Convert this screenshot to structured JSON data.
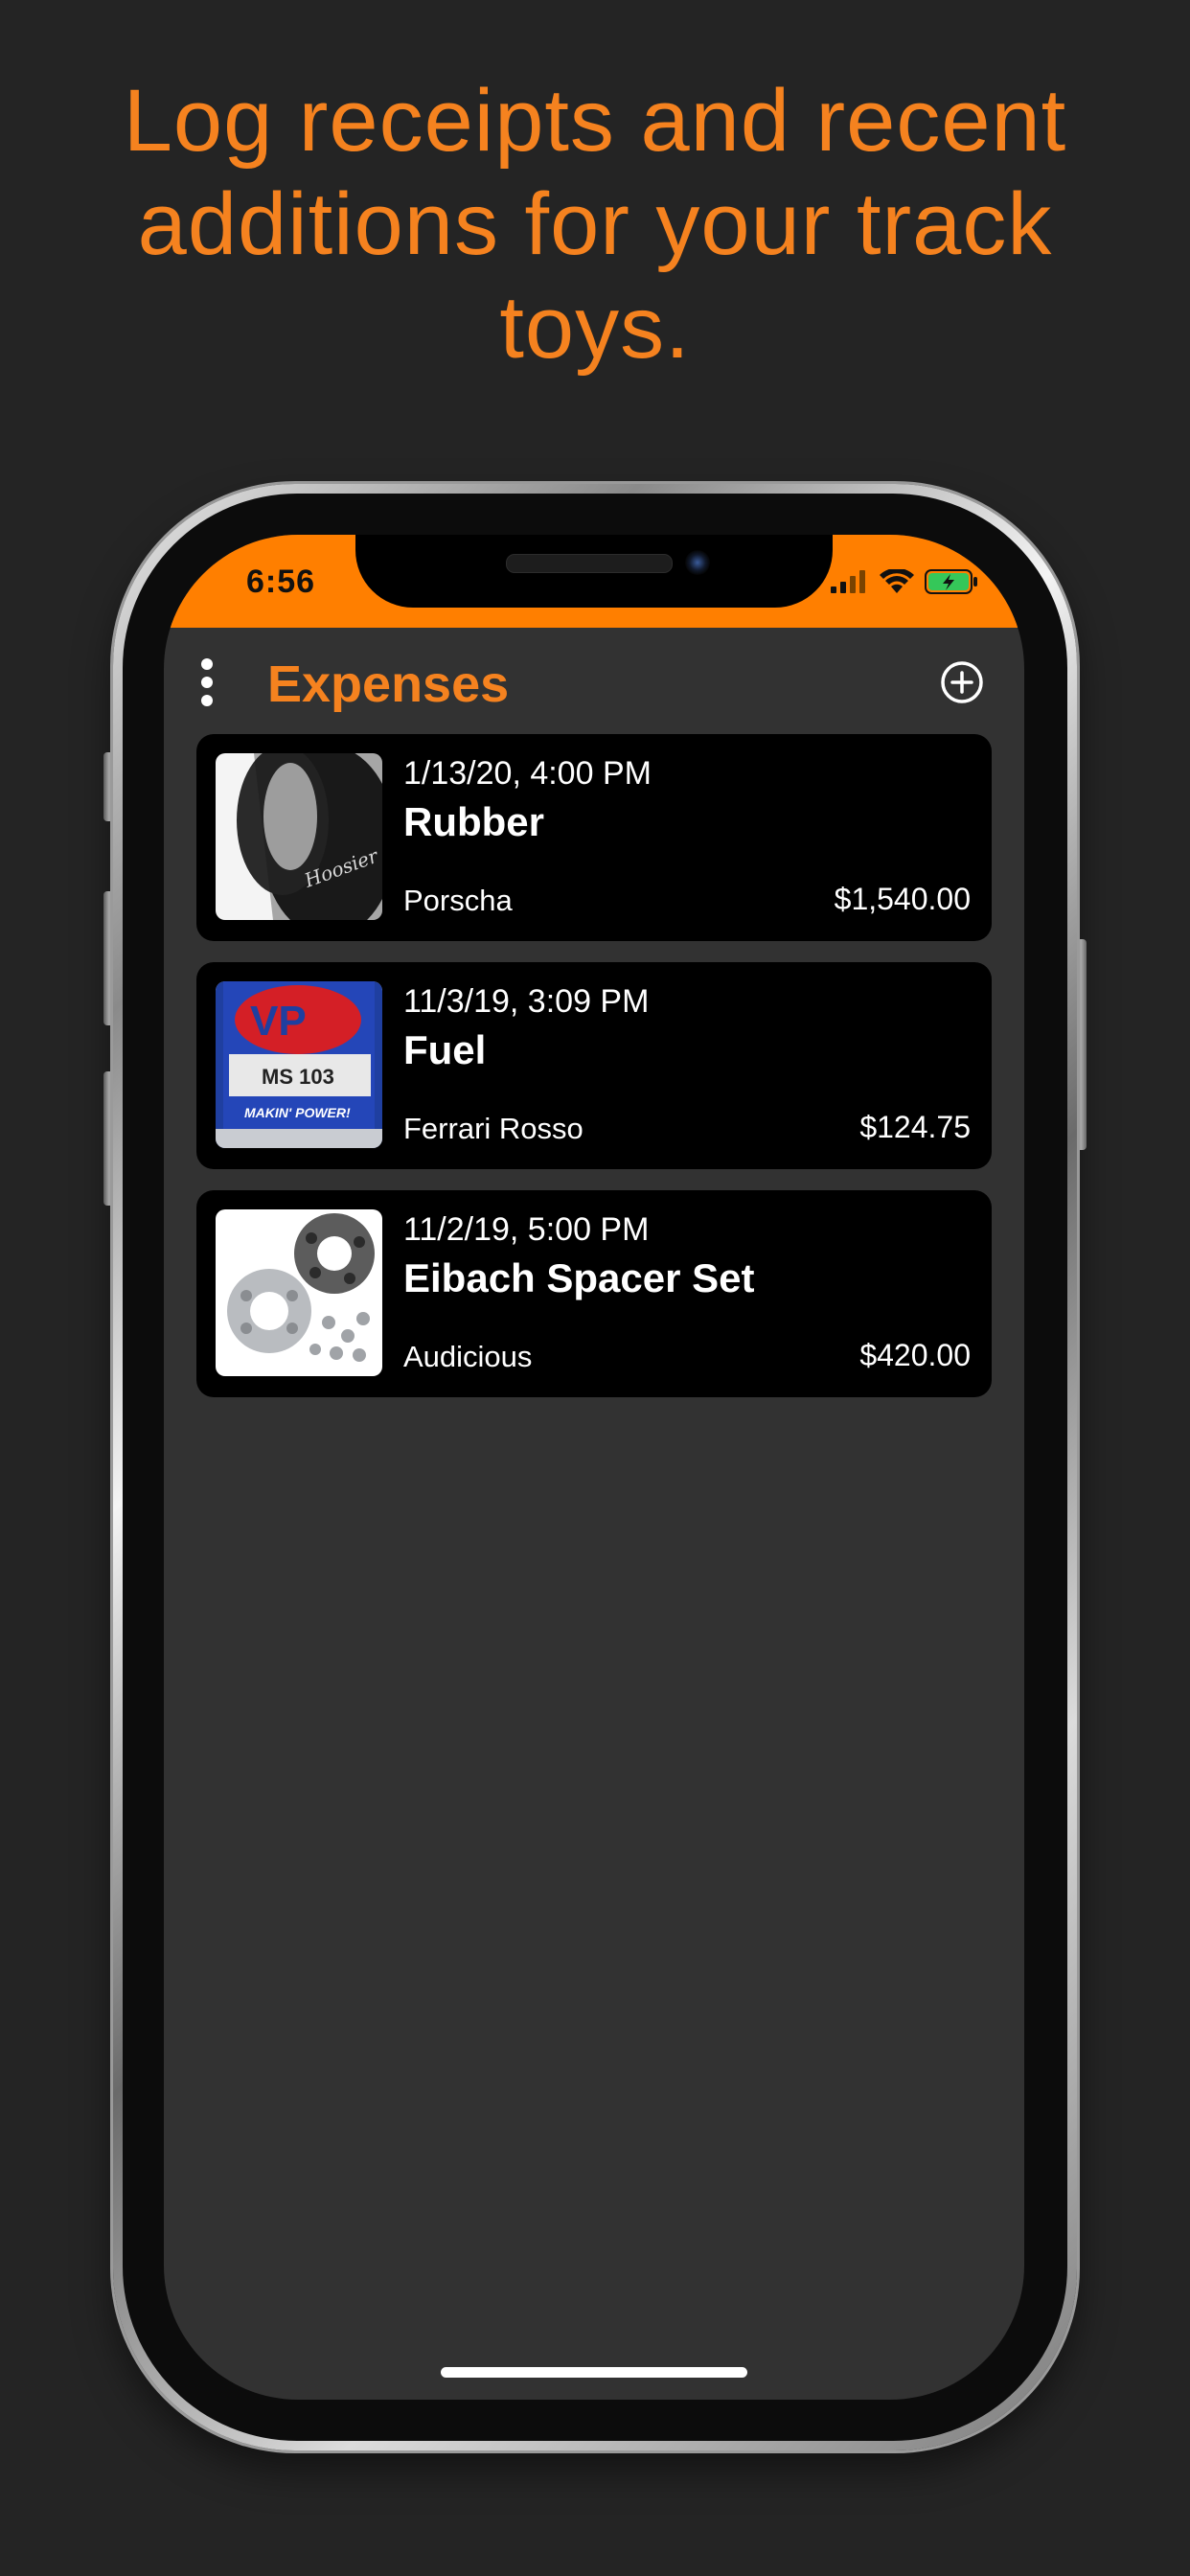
{
  "promo": {
    "headline_line1": "Log receipts and recent",
    "headline_line2": "additions for your track",
    "headline_line3": "toys."
  },
  "status_bar": {
    "time": "6:56",
    "background_color": "#FF7F00"
  },
  "nav": {
    "title": "Expenses",
    "menu_icon": "more-vertical-icon",
    "add_icon": "plus-circle-icon",
    "accent_color": "#F5821F"
  },
  "expenses": [
    {
      "date": "1/13/20, 4:00 PM",
      "title": "Rubber",
      "vehicle": "Porscha",
      "amount": "$1,540.00",
      "thumbnail_icon": "tire-photo",
      "thumbnail_text": "Hoosier"
    },
    {
      "date": "11/3/19, 3:09 PM",
      "title": "Fuel",
      "vehicle": "Ferrari Rosso",
      "amount": "$124.75",
      "thumbnail_icon": "fuel-drum-photo",
      "thumbnail_label": "MS 103",
      "thumbnail_brand": "VP",
      "thumbnail_tagline": "MAKIN' POWER!"
    },
    {
      "date": "11/2/19, 5:00 PM",
      "title": "Eibach Spacer Set",
      "vehicle": "Audicious",
      "amount": "$420.00",
      "thumbnail_icon": "wheel-spacer-photo"
    }
  ]
}
